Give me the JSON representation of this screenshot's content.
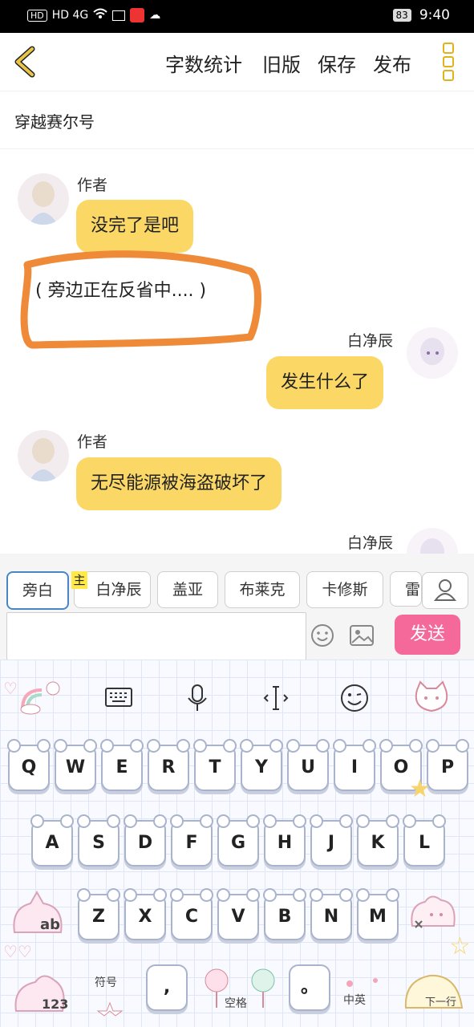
{
  "status_bar": {
    "left_icons": "HD 4G",
    "battery": "83",
    "time": "9:40"
  },
  "header": {
    "word_count": "字数统计",
    "old_version": "旧版",
    "save": "保存",
    "publish": "发布"
  },
  "story_title": "穿越赛尔号",
  "chat": {
    "msg1": {
      "name": "作者",
      "text": "没完了是吧"
    },
    "narration": "( 旁边正在反省中.... )",
    "msg2": {
      "name": "白净辰",
      "text": "发生什么了"
    },
    "msg3": {
      "name": "作者",
      "text": "无尽能源被海盗破坏了"
    },
    "msg4": {
      "name": "白净辰"
    }
  },
  "characters": {
    "main_mark": "主",
    "tabs": [
      "旁白",
      "白净辰",
      "盖亚",
      "布莱克",
      "卡修斯",
      "雷"
    ]
  },
  "composer": {
    "input_value": "",
    "send": "发送"
  },
  "keyboard": {
    "row1": [
      "Q",
      "W",
      "E",
      "R",
      "T",
      "Y",
      "U",
      "I",
      "O",
      "P"
    ],
    "row2": [
      "A",
      "S",
      "D",
      "F",
      "G",
      "H",
      "J",
      "K",
      "L"
    ],
    "row3": [
      "Z",
      "X",
      "C",
      "V",
      "B",
      "N",
      "M"
    ],
    "shift_label": "ab",
    "num_label": "123",
    "comma": ",",
    "period": "。",
    "space_label": "空格",
    "lang_label": "中英",
    "next_label": "下一行",
    "symbol_label": "符号"
  },
  "colors": {
    "bubble": "#fbd866",
    "send": "#f5699a",
    "accent": "#e0b31c",
    "annotation": "#ee8a38"
  }
}
